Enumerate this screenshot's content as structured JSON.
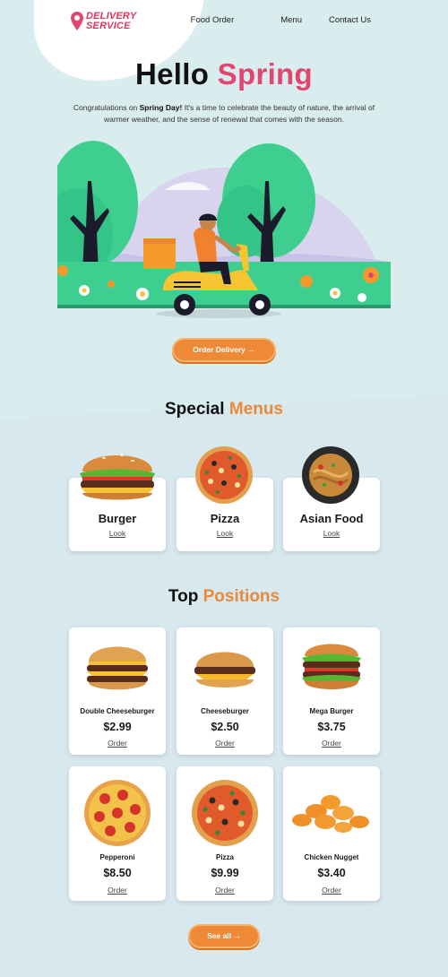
{
  "logo": {
    "line1": "DELIVERY",
    "line2": "SERVICE",
    "icon": "map-pin-icon"
  },
  "nav": {
    "items": [
      "Food Order",
      "Menu",
      "Contact Us"
    ]
  },
  "hero": {
    "title_plain": "Hello",
    "title_accent": "Spring",
    "text_before": "Congratulations on ",
    "text_bold": "Spring Day!",
    "text_after": " It's a time to celebrate the beauty of nature, the arrival of warmer weather, and the sense of renewal that comes with the season.",
    "button": "Order Delivery →"
  },
  "special_menus": {
    "title_plain": "Special",
    "title_accent": "Menus",
    "items": [
      {
        "name": "Burger",
        "link": "Look"
      },
      {
        "name": "Pizza",
        "link": "Look"
      },
      {
        "name": "Asian Food",
        "link": "Look"
      }
    ]
  },
  "top_positions": {
    "title_plain": "Top",
    "title_accent": "Positions",
    "items": [
      {
        "name": "Double Cheeseburger",
        "price": "$2.99",
        "link": "Order"
      },
      {
        "name": "Cheeseburger",
        "price": "$2.50",
        "link": "Order"
      },
      {
        "name": "Mega Burger",
        "price": "$3.75",
        "link": "Order"
      },
      {
        "name": "Pepperoni",
        "price": "$8.50",
        "link": "Order"
      },
      {
        "name": "Pizza",
        "price": "$9.99",
        "link": "Order"
      },
      {
        "name": "Chicken Nugget",
        "price": "$3.40",
        "link": "Order"
      }
    ],
    "see_all": "See all →"
  },
  "colors": {
    "brand_pink": "#e2456f",
    "accent_orange": "#ee8a37",
    "background": "#d7e8ee"
  }
}
